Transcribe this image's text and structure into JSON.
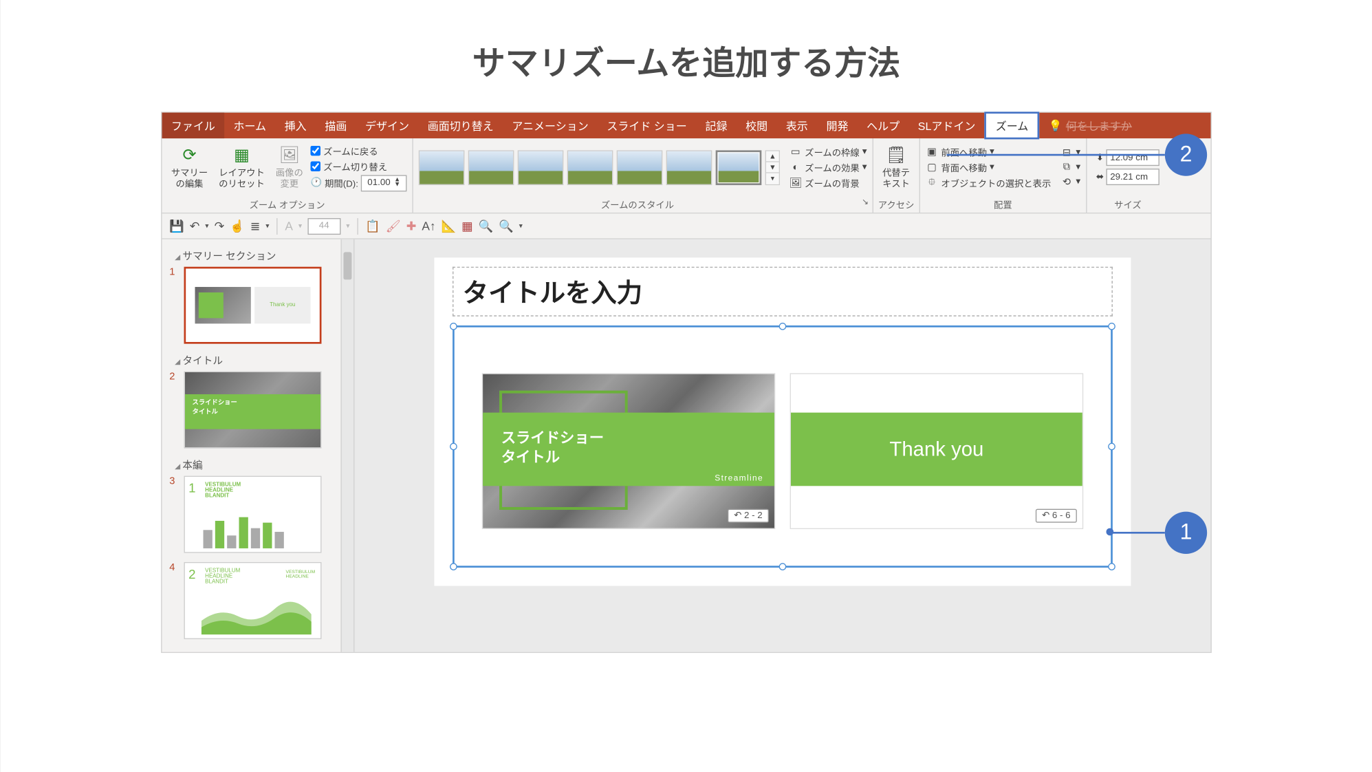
{
  "page": {
    "title": "サマリズームを追加する方法"
  },
  "callouts": {
    "c1": "1",
    "c2": "2"
  },
  "tabs": {
    "file": "ファイル",
    "home": "ホーム",
    "insert": "挿入",
    "draw": "描画",
    "design": "デザイン",
    "transitions": "画面切り替え",
    "animations": "アニメーション",
    "slideshow": "スライド ショー",
    "record": "記録",
    "review": "校閲",
    "view": "表示",
    "developer": "開発",
    "help": "ヘルプ",
    "sladdins": "SLアドイン",
    "zoom": "ズーム",
    "tellme": "何をしますか"
  },
  "ribbon": {
    "summary_edit": "サマリー\nの編集",
    "layout_reset": "レイアウト\nのリセット",
    "image_change": "画像の\n変更",
    "return_zoom": "ズームに戻る",
    "zoom_transition": "ズーム切り替え",
    "duration_label": "期間(D):",
    "duration_value": "01.00",
    "zoom_border": "ズームの枠線",
    "zoom_effect": "ズームの効果",
    "zoom_bg": "ズームの背景",
    "alt_text": "代替テ\nキスト",
    "bring_forward": "前面へ移動",
    "send_backward": "背面へ移動",
    "selection_pane": "オブジェクトの選択と表示",
    "height": "12.09 cm",
    "width": "29.21 cm",
    "g_options": "ズーム オプション",
    "g_styles": "ズームのスタイル",
    "g_access": "アクセシ",
    "g_arrange": "配置",
    "g_size": "サイズ"
  },
  "qat": {
    "fontsize": "44"
  },
  "thumbs": {
    "sec1": "サマリー セクション",
    "sec2": "タイトル",
    "sec3": "本編",
    "n1": "1",
    "n2": "2",
    "n3": "3",
    "n4": "4",
    "t2_title": "スライドショー\nタイトル",
    "t3_hd": "VESTIBULUM\nHEADLINE\nBLANDIT",
    "t4_hd": "VESTIBULUM\nHEADLINE\nBLANDIT",
    "t4_sub": "VESTIBULUM\nHEADLINE",
    "thank": "Thank you"
  },
  "slide": {
    "title_placeholder": "タイトルを入力",
    "card1_title": "スライドショー\nタイトル",
    "card1_stream": "Streamline",
    "card1_badge": "2 - 2",
    "card2_thank": "Thank you",
    "card2_badge": "6 - 6"
  }
}
